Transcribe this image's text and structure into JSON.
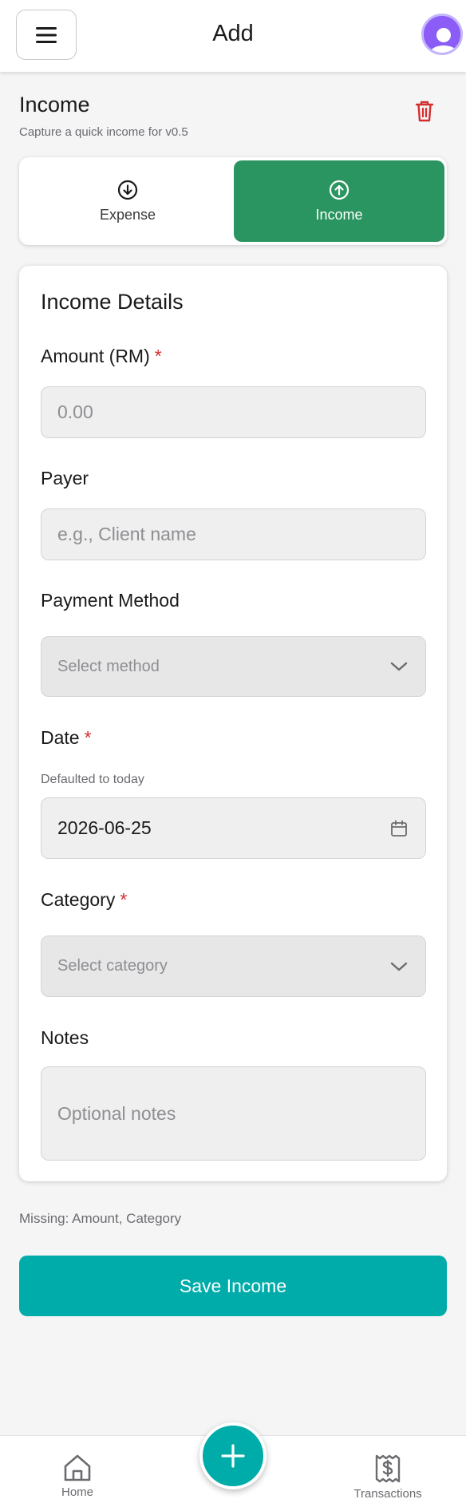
{
  "header": {
    "title": "Add"
  },
  "page": {
    "title": "Income",
    "subtitle": "Capture a quick income for v0.5"
  },
  "type_toggle": {
    "expense_label": "Expense",
    "income_label": "Income",
    "selected": "Income"
  },
  "form": {
    "card_title": "Income Details",
    "amount": {
      "label": "Amount (RM)",
      "required_mark": "*",
      "placeholder": "0.00"
    },
    "payer": {
      "label": "Payer",
      "placeholder": "e.g., Client name"
    },
    "payment_method": {
      "label": "Payment Method",
      "placeholder": "Select method"
    },
    "date": {
      "label": "Date",
      "required_mark": "*",
      "hint": "Defaulted to today",
      "value": "2026-06-25"
    },
    "category": {
      "label": "Category",
      "required_mark": "*",
      "placeholder": "Select category"
    },
    "notes": {
      "label": "Notes",
      "placeholder": "Optional notes"
    }
  },
  "status": {
    "missing_text": "Missing: Amount, Category"
  },
  "actions": {
    "save_label": "Save Income"
  },
  "bottom_nav": {
    "home_label": "Home",
    "transactions_label": "Transactions"
  },
  "icons": {
    "menu": "menu-icon",
    "avatar": "user-avatar-icon",
    "delete": "trash-icon",
    "expense": "arrow-down-circle-icon",
    "income": "arrow-up-circle-icon",
    "chevron": "chevron-down-icon",
    "calendar": "calendar-icon",
    "home": "home-icon",
    "add": "plus-icon",
    "transactions": "receipt-dollar-icon"
  },
  "colors": {
    "accent": "#00acaa",
    "income_green": "#2a9560",
    "danger": "#d32f2f",
    "avatar": "#8b5cf6"
  }
}
